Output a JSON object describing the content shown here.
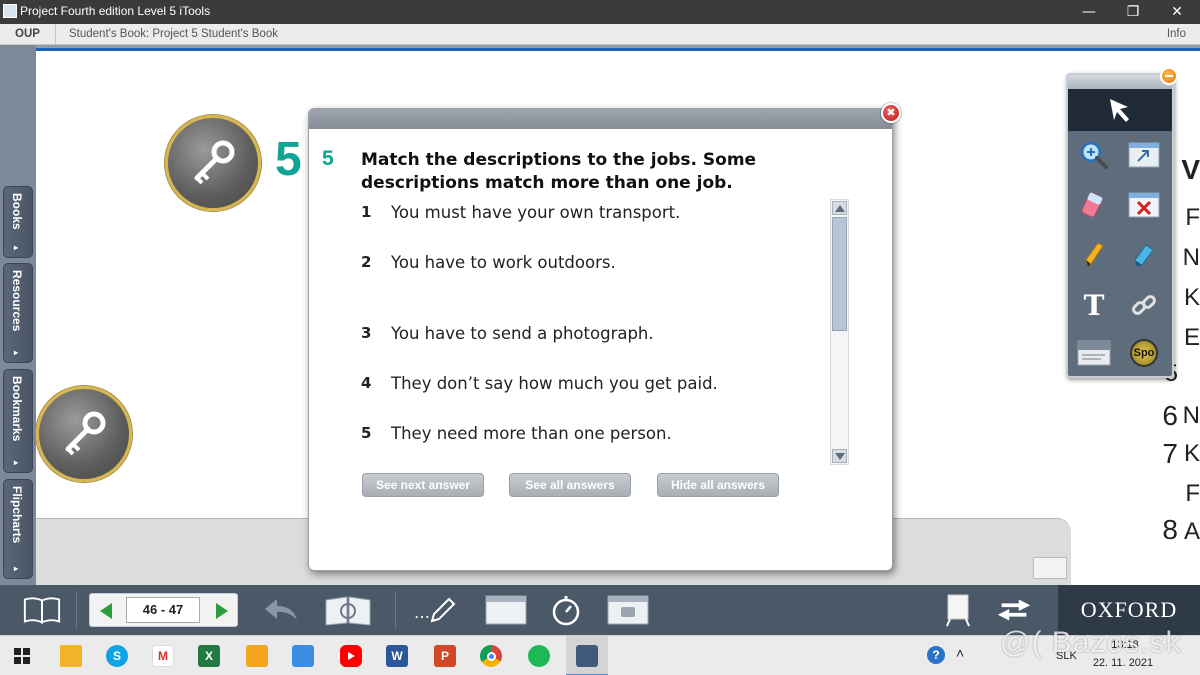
{
  "window": {
    "title": "Project Fourth edition Level 5 iTools",
    "min_glyph": "—",
    "max_glyph": "❐",
    "close_glyph": "✕"
  },
  "crumbbar": {
    "oup": "OUP",
    "breadcrumb": "Student's Book: Project 5 Student's Book",
    "info": "Info"
  },
  "sidebar": {
    "tabs": [
      {
        "label": "Books"
      },
      {
        "label": "Resources"
      },
      {
        "label": "Bookmarks"
      },
      {
        "label": "Flipcharts"
      }
    ],
    "arrow": "▸"
  },
  "page": {
    "exercise_number": "5",
    "right_column": [
      "V",
      "F",
      "N",
      "K",
      "E",
      "5",
      "6",
      "N",
      "7",
      "K",
      "F",
      "8",
      "A"
    ]
  },
  "dialog": {
    "close_glyph": "✖",
    "exercise_number": "5",
    "instruction": "Match the descriptions to the jobs. Some descriptions match more than one job.",
    "items": [
      {
        "num": "1",
        "text": "You must have your own transport."
      },
      {
        "num": "2",
        "text": "You have to work outdoors."
      },
      {
        "num": "3",
        "text": "You have to send a photograph."
      },
      {
        "num": "4",
        "text": "They don’t say how much you get paid."
      },
      {
        "num": "5",
        "text": "They need more than one person."
      }
    ],
    "buttons": {
      "next": "See next answer",
      "all": "See all answers",
      "hide": "Hide all answers"
    }
  },
  "toolbox": {
    "text_tool_glyph": "T",
    "spotlight_label": "Spo"
  },
  "apptoolbar": {
    "page_range": "46 - 47",
    "pen_glyph": "…",
    "brand": "OXFORD"
  },
  "taskbar": {
    "apps": {
      "skype": "S",
      "gmail": "M",
      "excel": "X",
      "word": "W",
      "powerpoint": "P"
    },
    "language": "SLK",
    "time": "13:18",
    "date": "22. 11. 2021",
    "help_glyph": "?",
    "tray_up_glyph": "˄"
  },
  "watermark": "@( Bazos.sk",
  "colors": {
    "accent_teal": "#10a592",
    "toolbar_blue": "#4b5868",
    "sidebar_blue": "#5b6778",
    "close_red": "#c01818",
    "key_ring_gold": "#d7b64f"
  }
}
